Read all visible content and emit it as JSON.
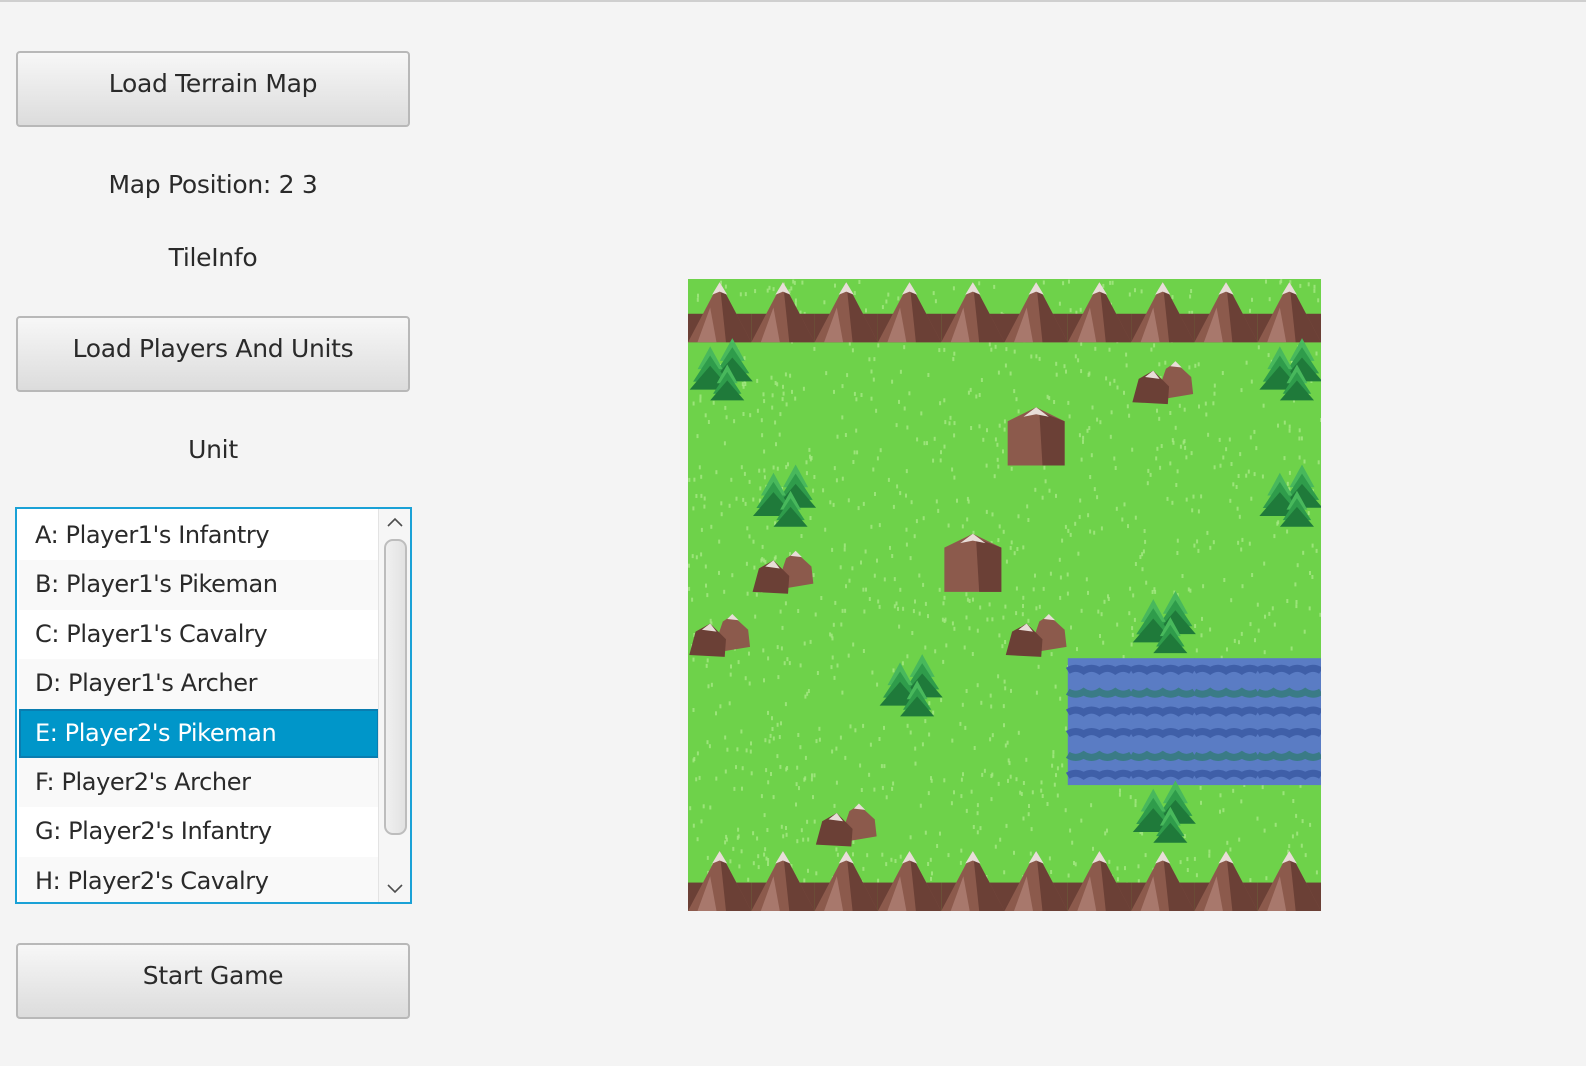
{
  "buttons": {
    "load_terrain_map": "Load Terrain Map",
    "load_players_and_units": "Load Players And Units",
    "start_game": "Start Game"
  },
  "map_position": "Map Position: 2 3",
  "tile_info": "TileInfo",
  "unit_label": "Unit",
  "unit_list": {
    "items": [
      "A: Player1's Infantry",
      "B: Player1's Pikeman",
      "C: Player1's Cavalry",
      "D: Player1's Archer",
      "E: Player2's Pikeman",
      "F: Player2's Archer",
      "G: Player2's Infantry",
      "H: Player2's Cavalry"
    ],
    "selected_index": 4
  },
  "terrain_map": {
    "columns": 10,
    "rows": 10,
    "tiles": [
      [
        "M",
        "M",
        "M",
        "M",
        "M",
        "M",
        "M",
        "M",
        "M",
        "M"
      ],
      [
        "T",
        "G",
        "G",
        "G",
        "G",
        "G",
        "G",
        "R",
        "G",
        "T"
      ],
      [
        "G",
        "G",
        "G",
        "G",
        "G",
        "B",
        "G",
        "G",
        "G",
        "G"
      ],
      [
        "G",
        "T",
        "G",
        "G",
        "G",
        "G",
        "G",
        "G",
        "G",
        "T"
      ],
      [
        "G",
        "R",
        "G",
        "G",
        "B",
        "G",
        "G",
        "G",
        "G",
        "G"
      ],
      [
        "R",
        "G",
        "G",
        "G",
        "G",
        "R",
        "G",
        "T",
        "G",
        "G"
      ],
      [
        "G",
        "G",
        "G",
        "T",
        "G",
        "G",
        "W",
        "W",
        "W",
        "W"
      ],
      [
        "G",
        "G",
        "G",
        "G",
        "G",
        "G",
        "W",
        "W",
        "W",
        "W"
      ],
      [
        "G",
        "G",
        "R",
        "G",
        "G",
        "G",
        "G",
        "T",
        "G",
        "G"
      ],
      [
        "M",
        "M",
        "M",
        "M",
        "M",
        "M",
        "M",
        "M",
        "M",
        "M"
      ]
    ],
    "legend": {
      "M": "mountain",
      "G": "grass",
      "T": "trees",
      "R": "rocks",
      "B": "boulder",
      "W": "water"
    },
    "colors": {
      "grass": "#6ed24a",
      "grass_fleck": "#a6e884",
      "mountain_dark": "#6b4036",
      "mountain_mid": "#8c5a4c",
      "mountain_light": "#b3857a",
      "snow": "#e8ddd8",
      "tree_dark": "#1f7a3a",
      "tree_mid": "#2f9c4b",
      "tree_light": "#48b85c",
      "water_dark": "#3f5fa8",
      "water_light": "#5a7cc4",
      "water_teal": "#3a7b86"
    }
  }
}
